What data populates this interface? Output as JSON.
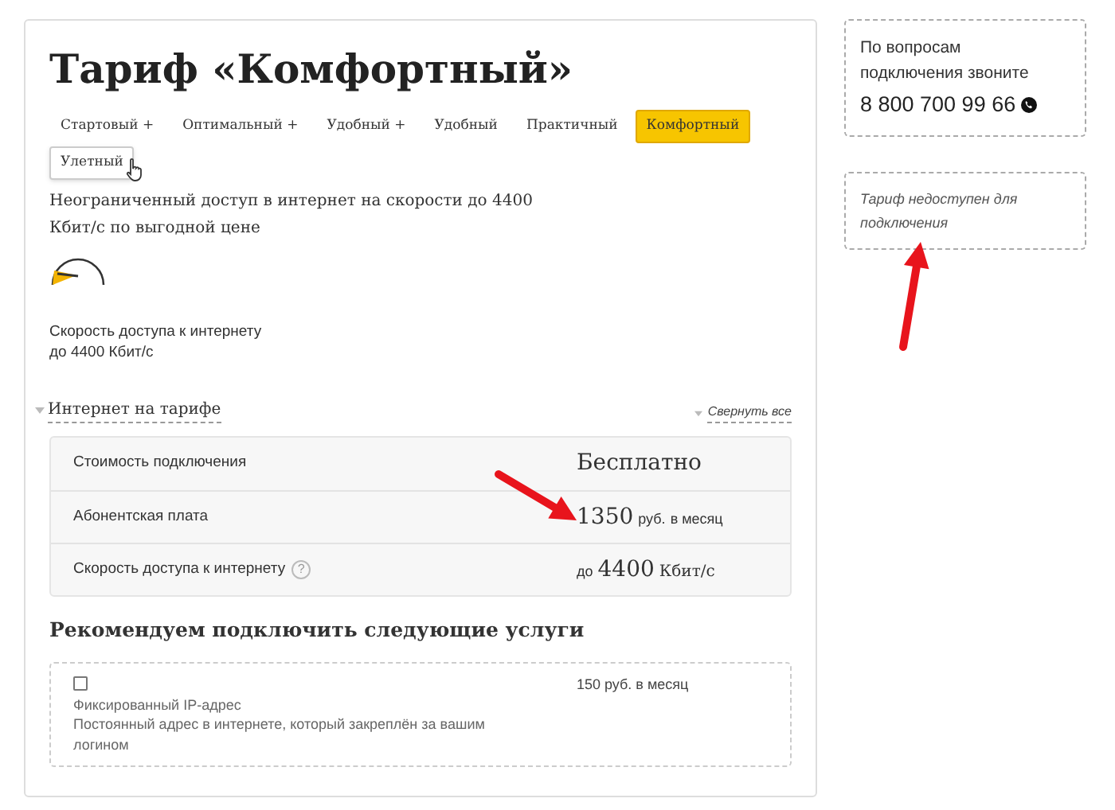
{
  "title": "Тариф «Комфортный»",
  "tabs": [
    {
      "label": "Стартовый +",
      "selected": false,
      "hovered": false
    },
    {
      "label": "Оптимальный +",
      "selected": false,
      "hovered": false
    },
    {
      "label": "Удобный +",
      "selected": false,
      "hovered": false
    },
    {
      "label": "Удобный",
      "selected": false,
      "hovered": false
    },
    {
      "label": "Практичный",
      "selected": false,
      "hovered": false
    },
    {
      "label": "Комфортный",
      "selected": true,
      "hovered": false
    },
    {
      "label": "Улетный",
      "selected": false,
      "hovered": true
    }
  ],
  "description": "Неограниченный доступ в интернет на скорости до 4400 Кбит/с по выгодной цене",
  "speed_caption": [
    "Скорость доступа к интернету",
    "до 4400 Кбит/с"
  ],
  "section": {
    "title": "Интернет на тарифе",
    "collapse_link": "Свернуть все",
    "rows": [
      {
        "kind": "plain",
        "label": "Стоимость подключения",
        "value": "Бесплатно"
      },
      {
        "kind": "price",
        "label": "Абонентская плата",
        "amount": "1350",
        "unit": "руб.",
        "suffix": "в месяц"
      },
      {
        "kind": "speed",
        "label": "Скорость доступа к интернету",
        "help": "?",
        "prefix": "до",
        "amount": "4400",
        "unit": "Кбит/с"
      }
    ]
  },
  "recommend": {
    "title": "Рекомендуем подключить следующие услуги",
    "services": [
      {
        "checked": false,
        "name": "Фиксированный IP-адрес",
        "description": "Постоянный адрес в интернете, который закреплён за вашим логином",
        "price": "150 руб. в месяц"
      }
    ]
  },
  "sidebar": {
    "contact": {
      "lines": [
        "По вопросам",
        "подключения звоните"
      ],
      "phone": "8 800 700 99 66"
    },
    "notice": "Тариф недоступен для подключения"
  }
}
